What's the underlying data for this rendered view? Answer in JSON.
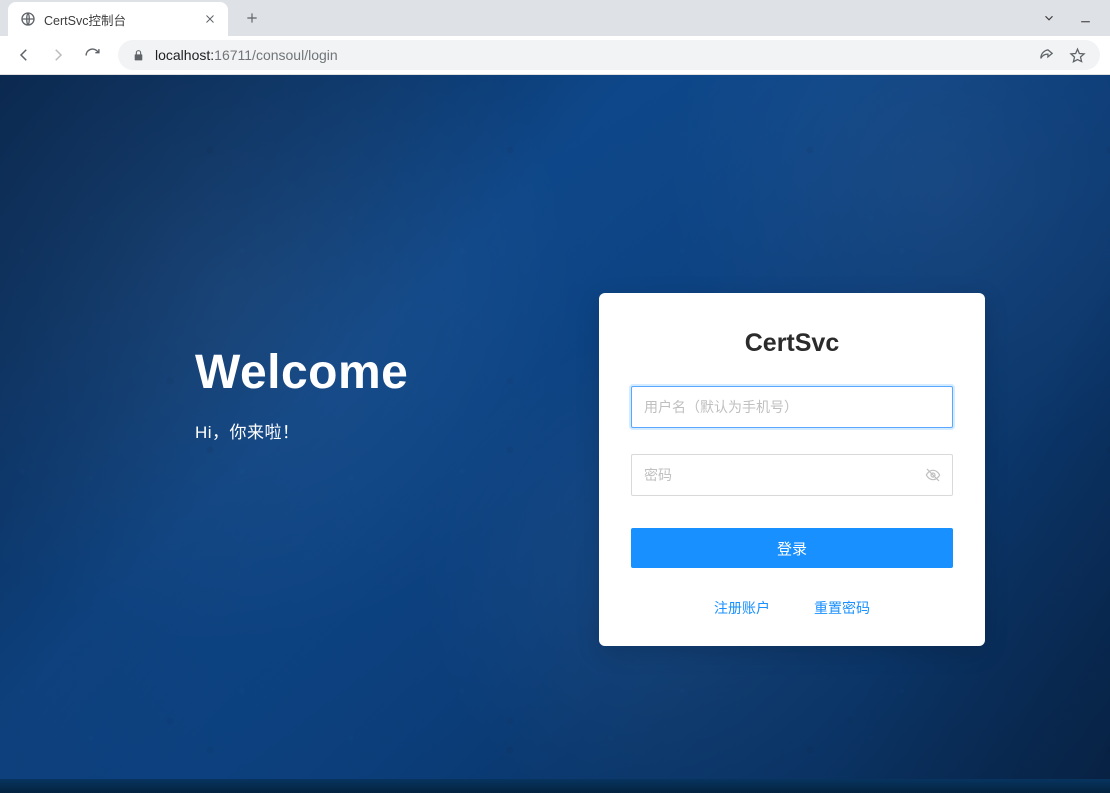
{
  "browser": {
    "tab_title": "CertSvc控制台",
    "url_host": "localhost:",
    "url_port_path": "16711/consoul/login"
  },
  "hero": {
    "title": "Welcome",
    "subtitle": "Hi，你来啦！"
  },
  "login": {
    "title": "CertSvc",
    "username_placeholder": "用户名（默认为手机号）",
    "password_placeholder": "密码",
    "submit_label": "登录",
    "register_label": "注册账户",
    "reset_label": "重置密码"
  }
}
